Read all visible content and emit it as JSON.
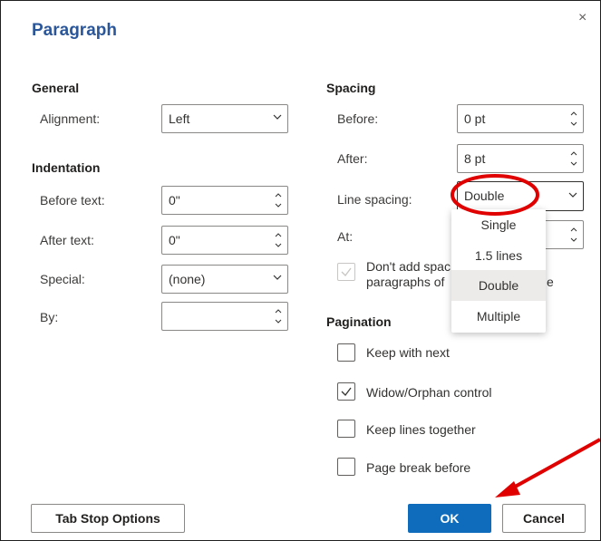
{
  "dialog": {
    "title": "Paragraph",
    "close_glyph": "×"
  },
  "general": {
    "heading": "General",
    "alignment_label": "Alignment:",
    "alignment_value": "Left"
  },
  "indentation": {
    "heading": "Indentation",
    "before_label": "Before text:",
    "before_value": "0\"",
    "after_label": "After text:",
    "after_value": "0\"",
    "special_label": "Special:",
    "special_value": "(none)",
    "by_label": "By:",
    "by_value": ""
  },
  "spacing": {
    "heading": "Spacing",
    "before_label": "Before:",
    "before_value": "0 pt",
    "after_label": "After:",
    "after_value": "8 pt",
    "line_spacing_label": "Line spacing:",
    "line_spacing_value": "Double",
    "at_label": "At:",
    "dont_add_line1": "Don't add spac",
    "dont_add_line2": "paragraphs of",
    "dont_add_tail": "e",
    "dont_add_checked": true,
    "dont_add_disabled": true
  },
  "line_spacing_options": [
    "Single",
    "1.5 lines",
    "Double",
    "Multiple"
  ],
  "line_spacing_selected": "Double",
  "pagination": {
    "heading": "Pagination",
    "keep_with_next": "Keep with next",
    "keep_with_next_checked": false,
    "widow_orphan": "Widow/Orphan control",
    "widow_orphan_checked": true,
    "keep_lines": "Keep lines together",
    "keep_lines_checked": false,
    "page_break": "Page break before",
    "page_break_checked": false
  },
  "buttons": {
    "tab_stop": "Tab Stop Options",
    "ok": "OK",
    "cancel": "Cancel"
  },
  "colors": {
    "title_blue": "#2b579a",
    "primary_blue": "#0f6cbd",
    "annotation_red": "#e00000"
  },
  "annotations": {
    "circle_around": "line-spacing-select",
    "arrow_points_to": "ok-button"
  }
}
